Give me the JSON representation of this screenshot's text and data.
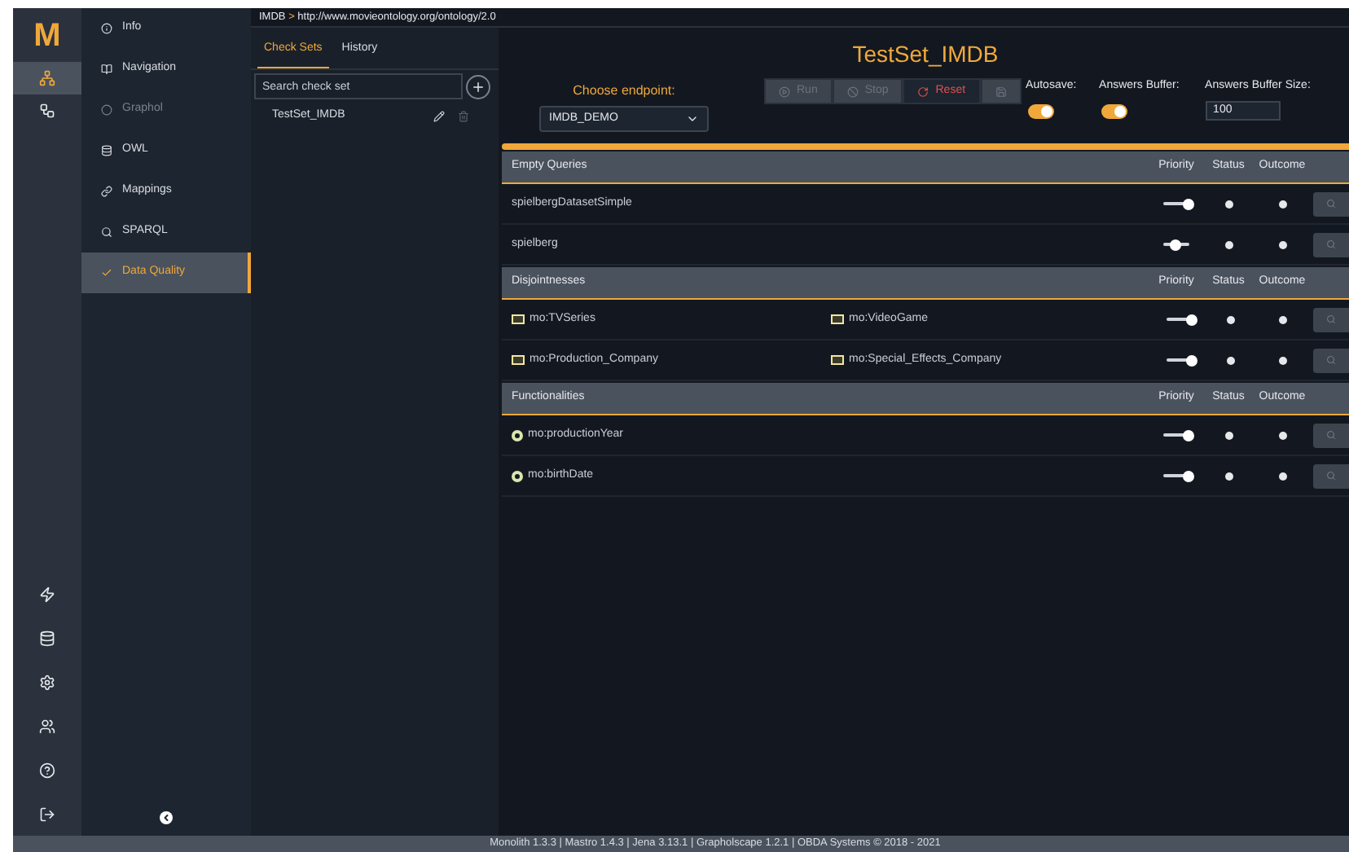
{
  "rail": {
    "logo": "M",
    "items": [
      {
        "kind": "hierarchy",
        "selected": true
      },
      {
        "kind": "network",
        "selected": false
      }
    ],
    "bottom_items": [
      {
        "kind": "bolt"
      },
      {
        "kind": "database"
      },
      {
        "kind": "settings"
      },
      {
        "kind": "users"
      },
      {
        "kind": "help"
      },
      {
        "kind": "logout"
      }
    ]
  },
  "nav": {
    "items": [
      {
        "label": "Info",
        "kind": "info",
        "selected": false,
        "disabled": false
      },
      {
        "label": "Navigation",
        "kind": "book",
        "selected": false,
        "disabled": false
      },
      {
        "label": "Graphol",
        "kind": "graphol",
        "selected": false,
        "disabled": true
      },
      {
        "label": "OWL",
        "kind": "owl",
        "selected": false,
        "disabled": false
      },
      {
        "label": "Mappings",
        "kind": "link",
        "selected": false,
        "disabled": false
      },
      {
        "label": "SPARQL",
        "kind": "search",
        "selected": false,
        "disabled": false
      },
      {
        "label": "Data Quality",
        "kind": "check",
        "selected": true,
        "disabled": false
      }
    ]
  },
  "breadcrumb": {
    "root": "IMDB",
    "separator": ">",
    "path": "http://www.movieontology.org/ontology/2.0"
  },
  "tabs": [
    {
      "label": "Check Sets",
      "selected": true
    },
    {
      "label": "History",
      "selected": false
    }
  ],
  "check_sets": {
    "search": {
      "placeholder": "Search check set"
    },
    "items": [
      {
        "label": "TestSet_IMDB"
      }
    ]
  },
  "main": {
    "title": "TestSet_IMDB",
    "endpoint": {
      "label": "Choose endpoint:",
      "value": "IMDB_DEMO"
    },
    "buttons": [
      {
        "label": "Run",
        "kind": "run",
        "disabled": true
      },
      {
        "label": "Stop",
        "kind": "stop",
        "disabled": true
      },
      {
        "label": "Reset",
        "kind": "reset",
        "disabled": false
      },
      {
        "kind": "save",
        "disabled": true
      }
    ],
    "autosave": {
      "label": "Autosave:",
      "on": true
    },
    "answers_buffer": {
      "label": "Answers Buffer:",
      "on": true
    },
    "buffer_size": {
      "label": "Answers Buffer Size:",
      "value": "100"
    },
    "sections": [
      {
        "title": "Empty Queries",
        "columns": [
          "Priority",
          "Status",
          "Outcome"
        ],
        "rows": [
          {
            "kind": "query",
            "name": "spielbergDatasetSimple",
            "level": 1
          },
          {
            "kind": "query",
            "name": "spielberg",
            "level": 0.5
          }
        ]
      },
      {
        "title": "Disjointnesses",
        "columns": [
          "Priority",
          "Status",
          "Outcome"
        ],
        "rows": [
          {
            "kind": "pair",
            "entities": [
              {
                "kind": "class",
                "name": "mo:TVSeries"
              },
              {
                "kind": "class",
                "name": "mo:VideoGame"
              }
            ],
            "level": 1
          },
          {
            "kind": "pair",
            "entities": [
              {
                "kind": "class",
                "name": "mo:Production_Company"
              },
              {
                "kind": "class",
                "name": "mo:Special_Effects_Company"
              }
            ],
            "level": 1
          }
        ]
      },
      {
        "title": "Functionalities",
        "columns": [
          "Priority",
          "Status",
          "Outcome"
        ],
        "rows": [
          {
            "kind": "pair",
            "entities": [
              {
                "kind": "data_property",
                "name": "mo:productionYear"
              }
            ],
            "level": 1
          },
          {
            "kind": "pair",
            "entities": [
              {
                "kind": "data_property",
                "name": "mo:birthDate"
              }
            ],
            "level": 1
          }
        ]
      }
    ]
  },
  "footer": "Monolith 1.3.3 | Mastro 1.4.3 | Jena 3.13.1 | Grapholscape 1.2.1 | OBDA Systems © 2018 - 2021"
}
